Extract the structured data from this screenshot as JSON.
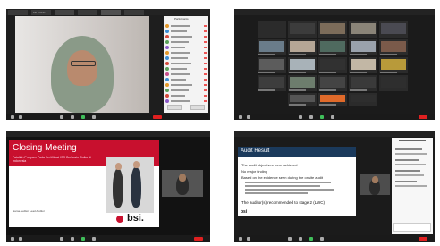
{
  "screens": {
    "top_left": {
      "speaker_name": "Ida Farida",
      "panel_title": "Participants"
    },
    "bottom_left": {
      "slide_title": "Closing Meeting",
      "slide_subtitle": "Fatullah Program Pada Sertifikasi ISO Berbasis Risiko di Indonesia",
      "slide_presenter": "Nama Auditor Lead Auditor",
      "brand": "bsi."
    },
    "bottom_right": {
      "slide_title": "Audit Result",
      "bullets": [
        "The audit objectives were achieved",
        "No major finding",
        "Based on the evidence seen during the onsite audit",
        "The auditor(s) recommended to stage 2 (LWC)"
      ],
      "footer_brand": "bsi"
    }
  },
  "colors": {
    "zoom_dark": "#1e1e1e",
    "end_button": "#e02020",
    "bsi_red": "#c8102e",
    "slide_blue": "#1b3a5c"
  },
  "icons": [
    "microphone-icon",
    "camera-icon",
    "participants-icon",
    "chat-icon",
    "share-screen-icon",
    "record-icon"
  ]
}
